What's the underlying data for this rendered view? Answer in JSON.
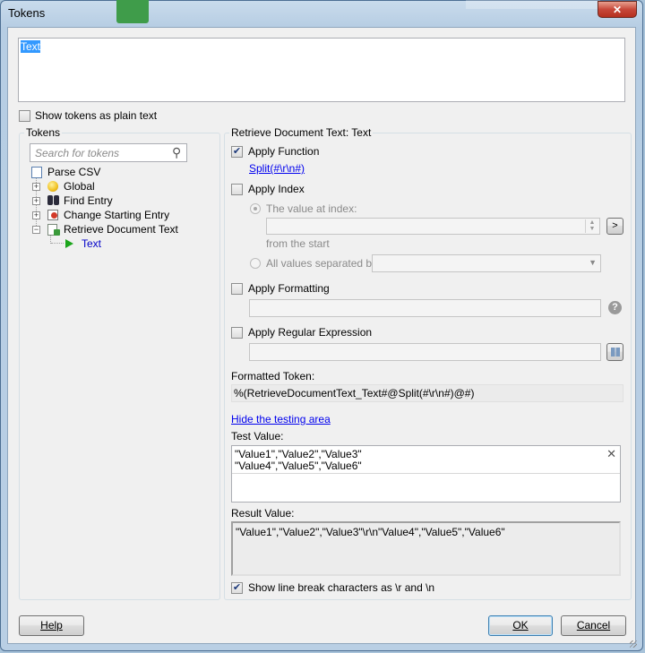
{
  "window": {
    "title": "Tokens",
    "close_glyph": "✕"
  },
  "token_text": "Text",
  "show_plain": {
    "label": "Show tokens as plain text",
    "checked": false
  },
  "tokens_group": {
    "legend": "Tokens",
    "search_placeholder": "Search for tokens",
    "tree": [
      {
        "label": "Parse CSV",
        "icon": "csv-doc-icon",
        "expander": ""
      },
      {
        "label": "Global",
        "icon": "globe-icon",
        "expander": "+"
      },
      {
        "label": "Find Entry",
        "icon": "binoculars-icon",
        "expander": "+"
      },
      {
        "label": "Change Starting Entry",
        "icon": "change-entry-icon",
        "expander": "+"
      },
      {
        "label": "Retrieve Document Text",
        "icon": "retrieve-doc-icon",
        "expander": "−"
      },
      {
        "label": "Text",
        "icon": "play-arrow-icon",
        "expander": ""
      }
    ]
  },
  "right": {
    "legend": "Retrieve Document Text: Text",
    "apply_function": {
      "label": "Apply Function",
      "checked": true,
      "link": "Split(#\\r\\n#)"
    },
    "apply_index": {
      "label": "Apply Index",
      "checked": false,
      "value_at_index": "The value at index:",
      "from_start": "from the  start",
      "all_values": "All values separated by:",
      "go_glyph": ">"
    },
    "apply_formatting": {
      "label": "Apply Formatting",
      "checked": false
    },
    "apply_regex": {
      "label": "Apply Regular Expression",
      "checked": false
    },
    "formatted_label": "Formatted Token:",
    "formatted_value": "%(RetrieveDocumentText_Text#@Split(#\\r\\n#)@#)",
    "hide_testing": "Hide the testing area",
    "test_label": "Test Value:",
    "test_lines": [
      "\"Value1\",\"Value2\",\"Value3\"",
      "\"Value4\",\"Value5\",\"Value6\""
    ],
    "result_label": "Result Value:",
    "result_value": "\"Value1\",\"Value2\",\"Value3\"\\r\\n\"Value4\",\"Value5\",\"Value6\"",
    "show_linebreaks": {
      "label": "Show line break characters as \\r and \\n",
      "checked": true
    }
  },
  "buttons": {
    "help": "Help",
    "ok": "OK",
    "cancel": "Cancel"
  }
}
